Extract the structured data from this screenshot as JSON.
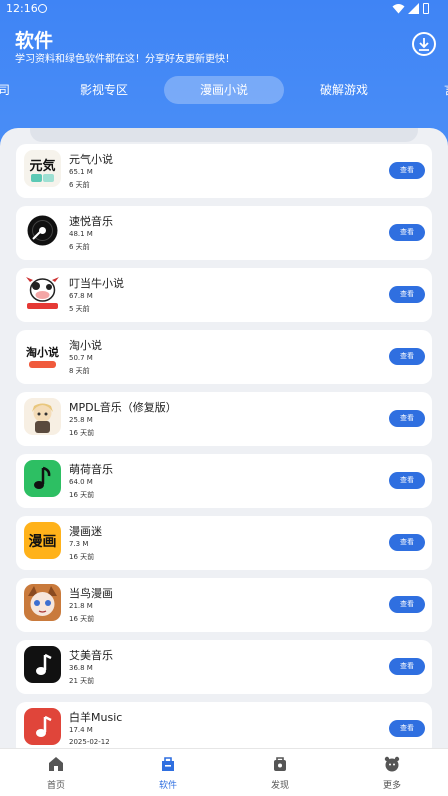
{
  "status": {
    "time": "12:16"
  },
  "header": {
    "title": "软件",
    "subtitle": "学习资料和绿色软件都在这！分享好友更新更快！"
  },
  "tabs": [
    {
      "label": "司"
    },
    {
      "label": "影视专区"
    },
    {
      "label": "漫画小说"
    },
    {
      "label": "破解游戏"
    },
    {
      "label": "言"
    }
  ],
  "apps": [
    {
      "name": "元气小说",
      "size": "65.1 M",
      "date": "6 天前",
      "button": "查看",
      "icon": "yuanqi-novel-icon"
    },
    {
      "name": "速悦音乐",
      "size": "48.1 M",
      "date": "6 天前",
      "button": "查看",
      "icon": "vinyl-record-icon"
    },
    {
      "name": "叮当牛小说",
      "size": "67.8 M",
      "date": "5 天前",
      "button": "查看",
      "icon": "cow-icon"
    },
    {
      "name": "淘小说",
      "size": "50.7 M",
      "date": "8 天前",
      "button": "查看",
      "icon": "tao-novel-icon"
    },
    {
      "name": "MPDL音乐（修复版）",
      "size": "25.8 M",
      "date": "16 天前",
      "button": "查看",
      "icon": "anime-girl-icon"
    },
    {
      "name": "萌荷音乐",
      "size": "64.0 M",
      "date": "16 天前",
      "button": "查看",
      "icon": "music-note-green-icon"
    },
    {
      "name": "漫画迷",
      "size": "7.3 M",
      "date": "16 天前",
      "button": "查看",
      "icon": "comic-fan-icon"
    },
    {
      "name": "当鸟漫画",
      "size": "21.8 M",
      "date": "16 天前",
      "button": "查看",
      "icon": "anime-character-icon"
    },
    {
      "name": "艾美音乐",
      "size": "36.8 M",
      "date": "21 天前",
      "button": "查看",
      "icon": "music-note-black-icon"
    },
    {
      "name": "白羊Music",
      "size": "17.4 M",
      "date": "2025-02-12",
      "button": "查看",
      "icon": "music-note-red-icon"
    }
  ],
  "nav": [
    {
      "label": "首页",
      "icon": "home-icon"
    },
    {
      "label": "软件",
      "icon": "software-bag-icon"
    },
    {
      "label": "发现",
      "icon": "discover-icon"
    },
    {
      "label": "更多",
      "icon": "more-face-icon"
    }
  ],
  "colors": {
    "header": "#4a8ef6",
    "accent": "#2f6fe0"
  }
}
